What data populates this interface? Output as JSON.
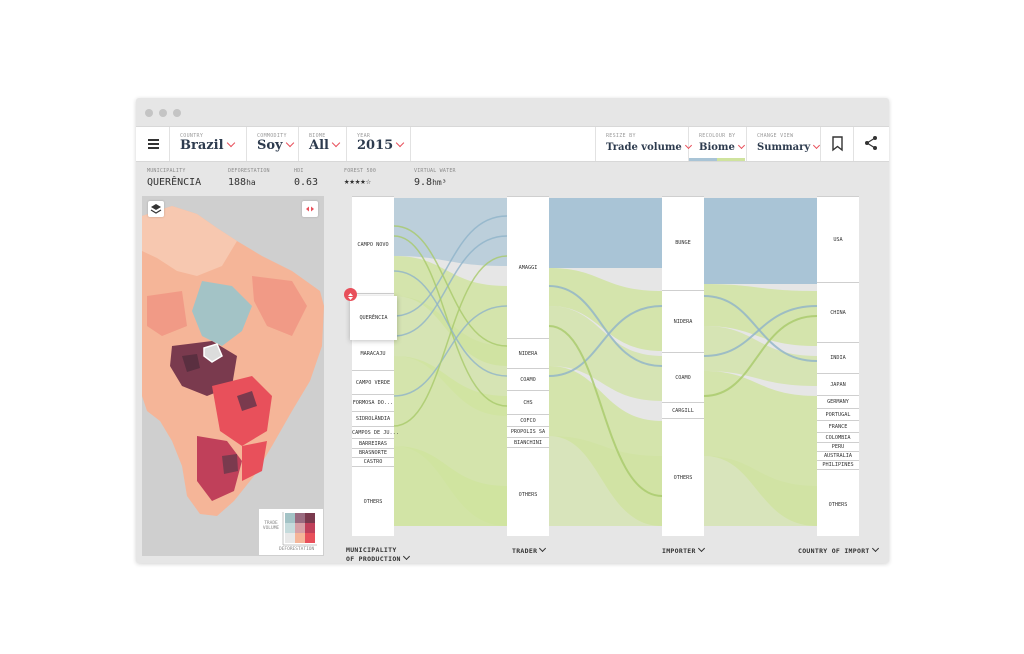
{
  "toolbar": {
    "country": {
      "label": "COUNTRY",
      "value": "Brazil"
    },
    "commodity": {
      "label": "COMMODITY",
      "value": "Soy"
    },
    "biome": {
      "label": "BIOME",
      "value": "All"
    },
    "year": {
      "label": "YEAR",
      "value": "2015"
    },
    "resize_by": {
      "label": "RESIZE BY",
      "value": "Trade volume"
    },
    "recolour_by": {
      "label": "RECOLOUR BY",
      "value": "Biome"
    },
    "change_view": {
      "label": "CHANGE VIEW",
      "value": "Summary"
    }
  },
  "stats": {
    "municipality": {
      "label": "MUNICIPALITY",
      "value": "QUERÊNCIA"
    },
    "deforestation": {
      "label": "DEFORESTATION",
      "value": "188",
      "unit": "ha"
    },
    "hdi": {
      "label": "HDI",
      "value": "0.63"
    },
    "forest_500": {
      "label": "FOREST 500",
      "value": "★★★★☆"
    },
    "virtual_water": {
      "label": "VIRTUAL WATER",
      "value": "9.8",
      "unit": "hm³"
    }
  },
  "map": {
    "legend_y_label": "TRADE VOLUME",
    "legend_x_label": "DEFORESTATION"
  },
  "sankey": {
    "columns": [
      {
        "header": "MUNICIPALITY\nOF PRODUCTION",
        "nodes": [
          "CAMPO NOVO",
          "QUERÊNCIA",
          "MARACAJU",
          "CAMPO VERDE",
          "FORMOSA DO...",
          "SIDROLÂNDIA",
          "CAMPOS DE JU...",
          "BARREIRAS",
          "BRASNORTE",
          "CASTRO",
          "OTHERS"
        ]
      },
      {
        "header": "TRADER",
        "nodes": [
          "AMAGGI",
          "NIDERA",
          "COAMO",
          "CHS",
          "COFCO",
          "PROPOLIS SA",
          "BIANCHINI",
          "OTHERS"
        ]
      },
      {
        "header": "IMPORTER",
        "nodes": [
          "BUNGE",
          "NIDERA",
          "COAMO",
          "CARGILL",
          "OTHERS"
        ]
      },
      {
        "header": "COUNTRY OF IMPORT",
        "nodes": [
          "USA",
          "CHINA",
          "INDIA",
          "JAPAN",
          "GERMANY",
          "PORTUGAL",
          "FRANCE",
          "COLOMBIA",
          "PERU",
          "AUSTRALIA",
          "PHILIPINES",
          "OTHERS"
        ]
      }
    ]
  },
  "colors": {
    "accent": "#e8505b",
    "navy": "#2d3b4e",
    "amazon_blue": "#a9c4d6",
    "cerrado_green": "#cfe39e",
    "map_peach": "#f5b598",
    "map_red": "#e8505b",
    "map_dark": "#7a3a4e"
  },
  "icons": {
    "menu": "hamburger-menu-icon",
    "bookmark": "bookmark-icon",
    "share": "share-icon",
    "layers": "layers-icon",
    "expand": "expand-arrows-icon"
  }
}
